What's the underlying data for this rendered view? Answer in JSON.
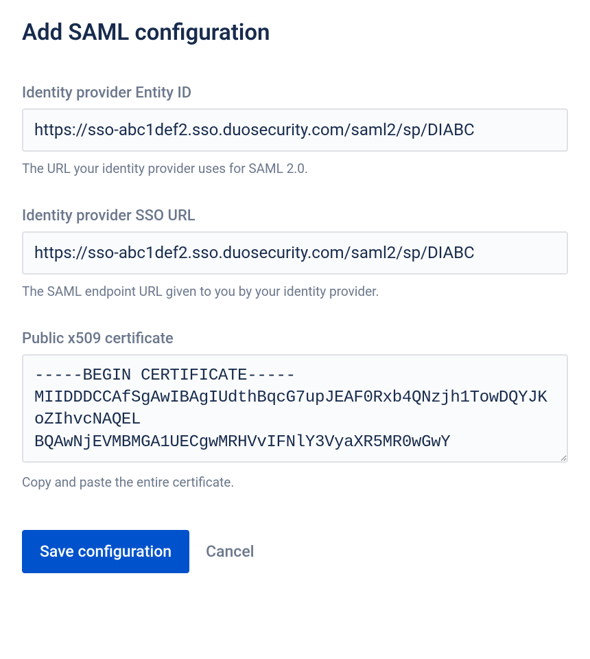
{
  "title": "Add SAML configuration",
  "fields": {
    "entity_id": {
      "label": "Identity provider Entity ID",
      "value": "https://sso-abc1def2.sso.duosecurity.com/saml2/sp/DIABC",
      "help": "The URL your identity provider uses for SAML 2.0."
    },
    "sso_url": {
      "label": "Identity provider SSO URL",
      "value": "https://sso-abc1def2.sso.duosecurity.com/saml2/sp/DIABC",
      "help": "The SAML endpoint URL given to you by your identity provider."
    },
    "certificate": {
      "label": "Public x509 certificate",
      "value": "-----BEGIN CERTIFICATE-----\nMIIDDDCCAfSgAwIBAgIUdthBqcG7upJEAF0Rxb4QNzjh1TowDQYJKoZIhvcNAQEL\nBQAwNjEVMBMGA1UECgwMRHVvIFNlY3VyaXR5MR0wGwY",
      "help": "Copy and paste the entire certificate."
    }
  },
  "buttons": {
    "save": "Save configuration",
    "cancel": "Cancel"
  }
}
